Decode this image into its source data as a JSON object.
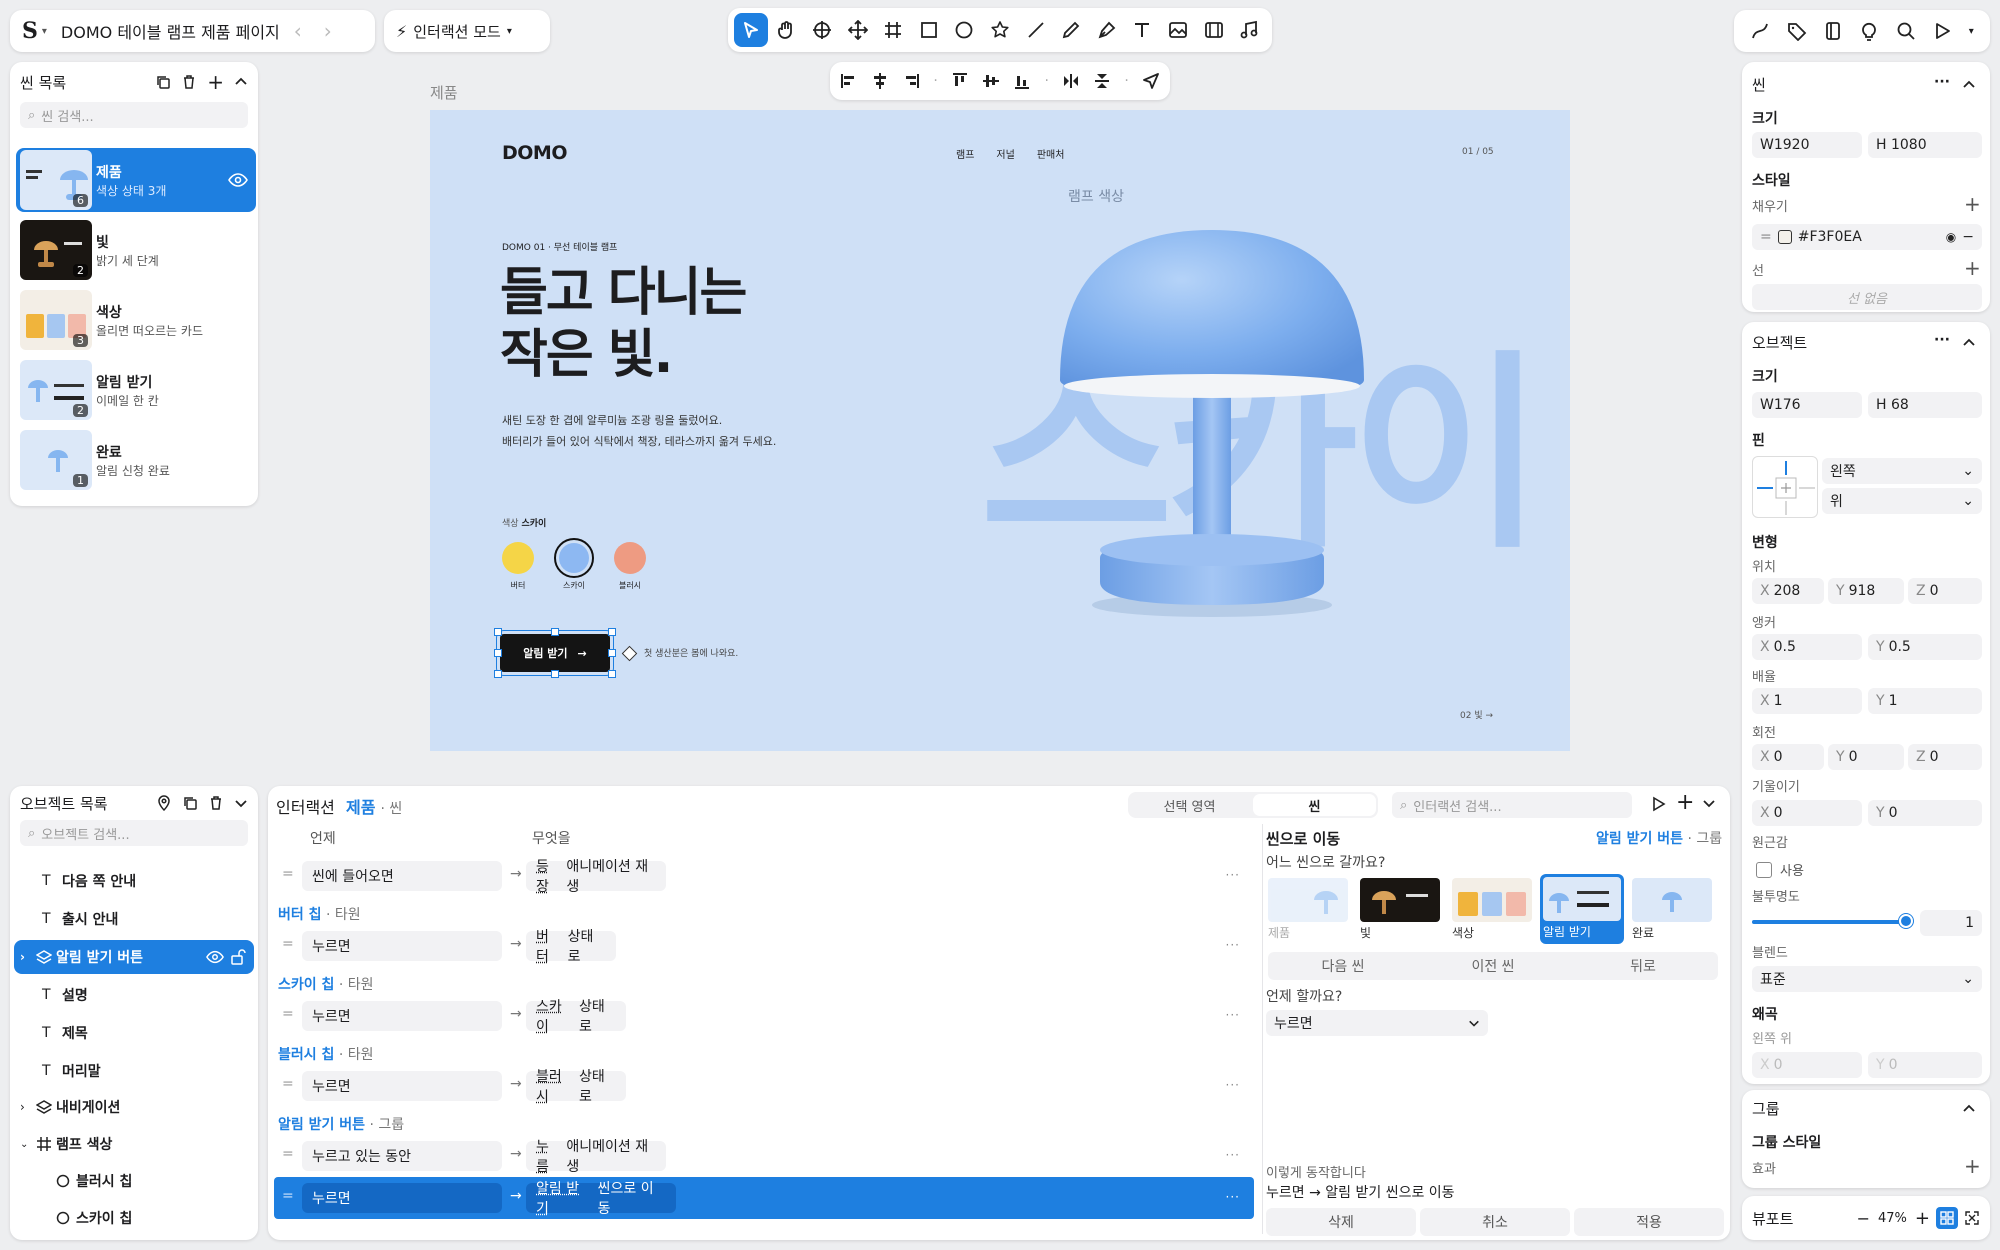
{
  "app": {
    "title": "DOMO 테이블 램프 제품 페이지",
    "mode": "인터랙션 모드"
  },
  "scenes": {
    "header": "씬 목록",
    "search_placeholder": "씬 검색...",
    "items": [
      {
        "title": "제품",
        "sub": "색상 상태 3개",
        "count": "6"
      },
      {
        "title": "빛",
        "sub": "밝기 세 단계",
        "count": "2"
      },
      {
        "title": "색상",
        "sub": "올리면 떠오르는 카드",
        "count": "3"
      },
      {
        "title": "알림 받기",
        "sub": "이메일 한 칸",
        "count": "2"
      },
      {
        "title": "완료",
        "sub": "알림 신청 완료",
        "count": "1"
      }
    ]
  },
  "canvas": {
    "frame_label": "제품",
    "brand": "DOMO",
    "nav": [
      "램프",
      "저널",
      "판매처"
    ],
    "page_num": "01 / 05",
    "swatch_title": "램프 색상",
    "eyebrow": "DOMO 01 · 무선 테이블 램프",
    "headline1": "들고 다니는",
    "headline2": "작은 빛.",
    "desc1": "새틴 도장 한 겹에 알루미늄 조광 링을 둘렀어요.",
    "desc2": "배터리가 들어 있어 식탁에서 책장, 테라스까지 옮겨 두세요.",
    "color_label": "색상",
    "color_value": "스카이",
    "swatches": [
      {
        "name": "버터",
        "color": "#F5D547"
      },
      {
        "name": "스카이",
        "color": "#8DB8F2"
      },
      {
        "name": "블러시",
        "color": "#EE9B82"
      }
    ],
    "cta": "알림 받기",
    "cta_note": "첫 생산분은 봄에 나와요.",
    "big_text": "스카이",
    "next": "02 빛 →"
  },
  "objects": {
    "header": "오브젝트 목록",
    "search_placeholder": "오브젝트 검색...",
    "items": [
      {
        "name": "다음 쪽 안내",
        "type": "text"
      },
      {
        "name": "출시 안내",
        "type": "text"
      },
      {
        "name": "알림 받기 버튼",
        "type": "group"
      },
      {
        "name": "설명",
        "type": "text"
      },
      {
        "name": "제목",
        "type": "text"
      },
      {
        "name": "머리말",
        "type": "text"
      },
      {
        "name": "내비게이션",
        "type": "group"
      },
      {
        "name": "램프 색상",
        "type": "frame"
      },
      {
        "name": "블러시 칩",
        "type": "ellipse"
      },
      {
        "name": "스카이 칩",
        "type": "ellipse"
      }
    ]
  },
  "interaction": {
    "title": "인터랙션",
    "scene": "제품",
    "scene_suffix": "· 씬",
    "tab_selection": "선택 영역",
    "tab_scene": "씬",
    "search_placeholder": "인터랙션 검색...",
    "col_when": "언제",
    "col_what": "무엇을",
    "rows": [
      {
        "group": "",
        "group_type": "",
        "when": "씬에 들어오면",
        "what": "등장",
        "what2": "애니메이션 재생"
      },
      {
        "group": "버터 칩",
        "group_type": "· 타원",
        "when": "누르면",
        "what": "버터",
        "what2": "상태로"
      },
      {
        "group": "스카이 칩",
        "group_type": "· 타원",
        "when": "누르면",
        "what": "스카이",
        "what2": "상태로"
      },
      {
        "group": "블러시 칩",
        "group_type": "· 타원",
        "when": "누르면",
        "what": "블러시",
        "what2": "상태로"
      },
      {
        "group": "알림 받기 버튼",
        "group_type": "· 그룹",
        "when": "누르고 있는 동안",
        "what": "누름",
        "what2": "애니메이션 재생"
      },
      {
        "group": "",
        "group_type": "",
        "when": "누르면",
        "what": "알림 받기",
        "what2": "씬으로 이동"
      }
    ],
    "detail": {
      "title": "씬으로 이동",
      "target": "알림 받기 버튼",
      "target_type": "· 그룹",
      "question": "어느 씬으로 갈까요?",
      "thumbs": [
        "제품",
        "빛",
        "색상",
        "알림 받기",
        "완료"
      ],
      "nav_next": "다음 씬",
      "nav_prev": "이전 씬",
      "nav_back": "뒤로",
      "when_q": "언제 할까요?",
      "when_value": "누르면",
      "summary_label": "이렇게 동작합니다",
      "summary": "누르면 → 알림 받기 씬으로 이동",
      "btn_delete": "삭제",
      "btn_cancel": "취소",
      "btn_apply": "적용"
    }
  },
  "inspector": {
    "scene_header": "씬",
    "size_label": "크기",
    "scene_w": "W1920",
    "scene_h": "H 1080",
    "style_label": "스타일",
    "fill_label": "채우기",
    "fill_value": "#F3F0EA",
    "stroke_label": "선",
    "stroke_none": "선 없음",
    "object_header": "오브젝트",
    "obj_w": "W176",
    "obj_h": "H 68",
    "pin_label": "핀",
    "pin_h": "왼쪽",
    "pin_v": "위",
    "transform_label": "변형",
    "position_label": "위치",
    "pos_x": "208",
    "pos_y": "918",
    "pos_z": "0",
    "anchor_label": "앵커",
    "anchor_x": "0.5",
    "anchor_y": "0.5",
    "scale_label": "배율",
    "scale_x": "1",
    "scale_y": "1",
    "rotation_label": "회전",
    "rot_x": "0",
    "rot_y": "0",
    "rot_z": "0",
    "skew_label": "기울이기",
    "skew_x": "0",
    "skew_y": "0",
    "perspective_label": "원근감",
    "perspective_use": "사용",
    "opacity_label": "불투명도",
    "opacity_value": "1",
    "opacity_level": 1,
    "blend_label": "블렌드",
    "blend_value": "표준",
    "distort_label": "왜곡",
    "distort_pos": "왼쪽 위",
    "distort_x": "0",
    "distort_y": "0",
    "group_header": "그룹",
    "group_style": "그룹 스타일",
    "effects_label": "효과",
    "viewport_label": "뷰포트",
    "zoom": "47%"
  },
  "colors": {
    "accent": "#1E7FE0",
    "canvas_bg": "#CFE0F6",
    "big_text": "#A9C8F2",
    "lamp": "#86B6F0"
  }
}
